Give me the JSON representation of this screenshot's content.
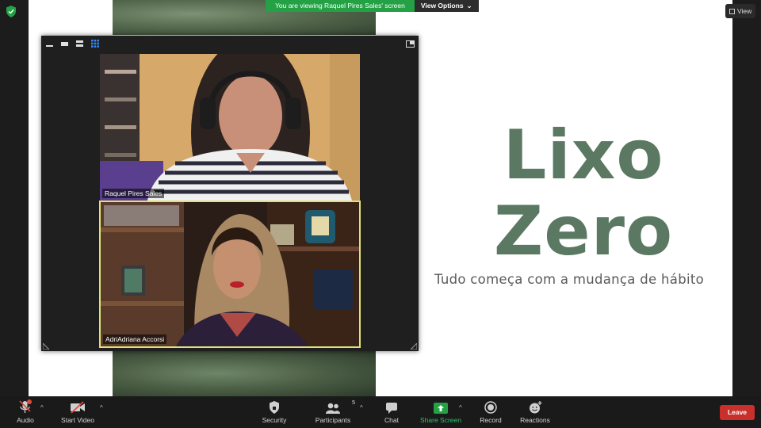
{
  "banner": {
    "message": "You are viewing Raquel Pires Sales' screen",
    "view_options": "View Options"
  },
  "view_button": "View",
  "slide": {
    "title_line1": "Lixo",
    "title_line2": "Zero",
    "subtitle": "Tudo começa com a mudança de hábito",
    "title_color": "#5a7862"
  },
  "participants_gallery": [
    {
      "name": "Raquel Pires Sales",
      "active_speaker": false
    },
    {
      "name": "AdriAdriana Accorsi",
      "active_speaker": true
    }
  ],
  "toolbar": {
    "audio": "Audio",
    "start_video": "Start Video",
    "security": "Security",
    "participants": "Participants",
    "participants_count": "5",
    "chat": "Chat",
    "share_screen": "Share Screen",
    "record": "Record",
    "reactions": "Reactions",
    "leave": "Leave"
  },
  "colors": {
    "share_green": "#23a144",
    "leave_red": "#c9302c",
    "speaker_highlight": "#dfe27a"
  }
}
